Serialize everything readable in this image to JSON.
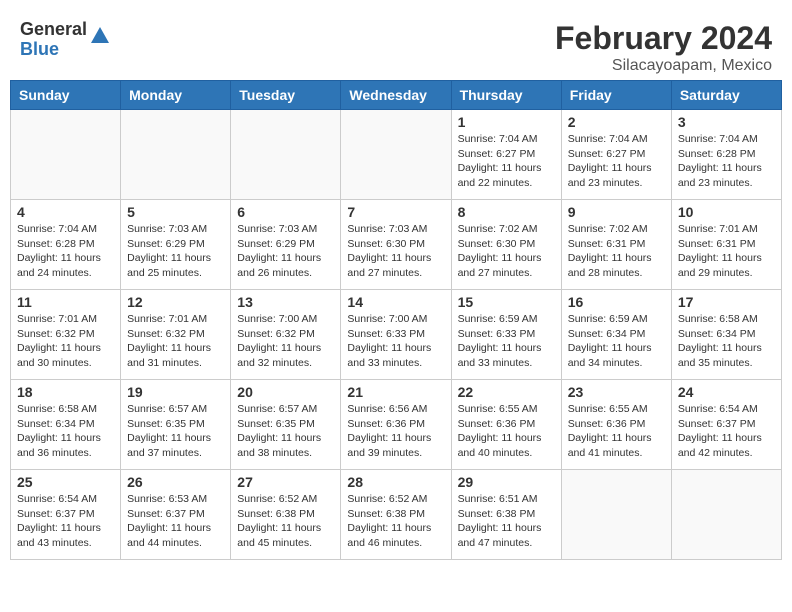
{
  "header": {
    "logo_general": "General",
    "logo_blue": "Blue",
    "title": "February 2024",
    "subtitle": "Silacayoapam, Mexico"
  },
  "days_of_week": [
    "Sunday",
    "Monday",
    "Tuesday",
    "Wednesday",
    "Thursday",
    "Friday",
    "Saturday"
  ],
  "weeks": [
    [
      {
        "day": "",
        "sunrise": "",
        "sunset": "",
        "daylight": ""
      },
      {
        "day": "",
        "sunrise": "",
        "sunset": "",
        "daylight": ""
      },
      {
        "day": "",
        "sunrise": "",
        "sunset": "",
        "daylight": ""
      },
      {
        "day": "",
        "sunrise": "",
        "sunset": "",
        "daylight": ""
      },
      {
        "day": "1",
        "sunrise": "7:04 AM",
        "sunset": "6:27 PM",
        "daylight": "11 hours and 22 minutes."
      },
      {
        "day": "2",
        "sunrise": "7:04 AM",
        "sunset": "6:27 PM",
        "daylight": "11 hours and 23 minutes."
      },
      {
        "day": "3",
        "sunrise": "7:04 AM",
        "sunset": "6:28 PM",
        "daylight": "11 hours and 23 minutes."
      }
    ],
    [
      {
        "day": "4",
        "sunrise": "7:04 AM",
        "sunset": "6:28 PM",
        "daylight": "11 hours and 24 minutes."
      },
      {
        "day": "5",
        "sunrise": "7:03 AM",
        "sunset": "6:29 PM",
        "daylight": "11 hours and 25 minutes."
      },
      {
        "day": "6",
        "sunrise": "7:03 AM",
        "sunset": "6:29 PM",
        "daylight": "11 hours and 26 minutes."
      },
      {
        "day": "7",
        "sunrise": "7:03 AM",
        "sunset": "6:30 PM",
        "daylight": "11 hours and 27 minutes."
      },
      {
        "day": "8",
        "sunrise": "7:02 AM",
        "sunset": "6:30 PM",
        "daylight": "11 hours and 27 minutes."
      },
      {
        "day": "9",
        "sunrise": "7:02 AM",
        "sunset": "6:31 PM",
        "daylight": "11 hours and 28 minutes."
      },
      {
        "day": "10",
        "sunrise": "7:01 AM",
        "sunset": "6:31 PM",
        "daylight": "11 hours and 29 minutes."
      }
    ],
    [
      {
        "day": "11",
        "sunrise": "7:01 AM",
        "sunset": "6:32 PM",
        "daylight": "11 hours and 30 minutes."
      },
      {
        "day": "12",
        "sunrise": "7:01 AM",
        "sunset": "6:32 PM",
        "daylight": "11 hours and 31 minutes."
      },
      {
        "day": "13",
        "sunrise": "7:00 AM",
        "sunset": "6:32 PM",
        "daylight": "11 hours and 32 minutes."
      },
      {
        "day": "14",
        "sunrise": "7:00 AM",
        "sunset": "6:33 PM",
        "daylight": "11 hours and 33 minutes."
      },
      {
        "day": "15",
        "sunrise": "6:59 AM",
        "sunset": "6:33 PM",
        "daylight": "11 hours and 33 minutes."
      },
      {
        "day": "16",
        "sunrise": "6:59 AM",
        "sunset": "6:34 PM",
        "daylight": "11 hours and 34 minutes."
      },
      {
        "day": "17",
        "sunrise": "6:58 AM",
        "sunset": "6:34 PM",
        "daylight": "11 hours and 35 minutes."
      }
    ],
    [
      {
        "day": "18",
        "sunrise": "6:58 AM",
        "sunset": "6:34 PM",
        "daylight": "11 hours and 36 minutes."
      },
      {
        "day": "19",
        "sunrise": "6:57 AM",
        "sunset": "6:35 PM",
        "daylight": "11 hours and 37 minutes."
      },
      {
        "day": "20",
        "sunrise": "6:57 AM",
        "sunset": "6:35 PM",
        "daylight": "11 hours and 38 minutes."
      },
      {
        "day": "21",
        "sunrise": "6:56 AM",
        "sunset": "6:36 PM",
        "daylight": "11 hours and 39 minutes."
      },
      {
        "day": "22",
        "sunrise": "6:55 AM",
        "sunset": "6:36 PM",
        "daylight": "11 hours and 40 minutes."
      },
      {
        "day": "23",
        "sunrise": "6:55 AM",
        "sunset": "6:36 PM",
        "daylight": "11 hours and 41 minutes."
      },
      {
        "day": "24",
        "sunrise": "6:54 AM",
        "sunset": "6:37 PM",
        "daylight": "11 hours and 42 minutes."
      }
    ],
    [
      {
        "day": "25",
        "sunrise": "6:54 AM",
        "sunset": "6:37 PM",
        "daylight": "11 hours and 43 minutes."
      },
      {
        "day": "26",
        "sunrise": "6:53 AM",
        "sunset": "6:37 PM",
        "daylight": "11 hours and 44 minutes."
      },
      {
        "day": "27",
        "sunrise": "6:52 AM",
        "sunset": "6:38 PM",
        "daylight": "11 hours and 45 minutes."
      },
      {
        "day": "28",
        "sunrise": "6:52 AM",
        "sunset": "6:38 PM",
        "daylight": "11 hours and 46 minutes."
      },
      {
        "day": "29",
        "sunrise": "6:51 AM",
        "sunset": "6:38 PM",
        "daylight": "11 hours and 47 minutes."
      },
      {
        "day": "",
        "sunrise": "",
        "sunset": "",
        "daylight": ""
      },
      {
        "day": "",
        "sunrise": "",
        "sunset": "",
        "daylight": ""
      }
    ]
  ],
  "labels": {
    "sunrise": "Sunrise:",
    "sunset": "Sunset:",
    "daylight": "Daylight:"
  }
}
